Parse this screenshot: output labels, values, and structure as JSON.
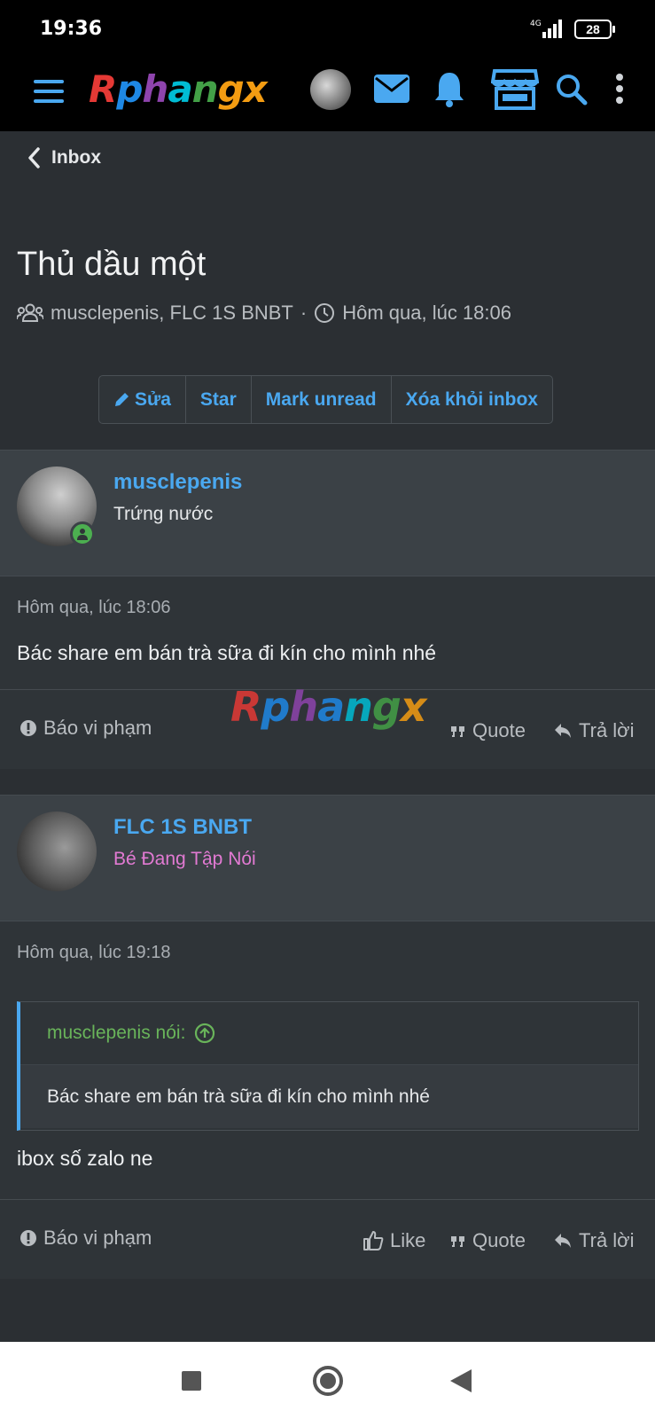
{
  "status_bar": {
    "time": "19:36",
    "network": "4G",
    "battery": "28"
  },
  "header": {
    "logo": "Rphangx"
  },
  "page": {
    "back_label": "Inbox",
    "title": "Thủ dầu một",
    "participants": "musclepenis, FLC 1S BNBT",
    "separator": "·",
    "time": "Hôm qua, lúc 18:06"
  },
  "buttons": {
    "edit": "Sửa",
    "star": "Star",
    "mark_unread": "Mark unread",
    "remove": "Xóa khỏi inbox"
  },
  "messages": [
    {
      "user": "musclepenis",
      "user_title": "Trứng nước",
      "user_title_color": "#e6e8ea",
      "date": "Hôm qua, lúc 18:06",
      "body": "Bác share em bán trà sữa đi kín cho mình nhé",
      "report": "Báo vi phạm",
      "quote": "Quote",
      "reply": "Trả lời"
    },
    {
      "user": "FLC 1S BNBT",
      "user_title": "Bé Đang Tập Nói",
      "user_title_color": "#e27ad3",
      "date": "Hôm qua, lúc 19:18",
      "quote_author": "musclepenis nói:",
      "quote_text": "Bác share em bán trà sữa đi kín cho mình nhé",
      "body": "ibox số zalo ne",
      "report": "Báo vi phạm",
      "like": "Like",
      "quote": "Quote",
      "reply": "Trả lời"
    }
  ],
  "watermark": "Rphangx",
  "colors": {
    "accent": "#4aa8f0",
    "online": "#4caf50",
    "quote_author": "#69b45a"
  },
  "icons": [
    "menu-icon",
    "envelope-icon",
    "bell-icon",
    "store-icon",
    "search-icon",
    "more-vertical-icon",
    "chevron-left-icon",
    "users-icon",
    "clock-icon",
    "pencil-icon",
    "alert-icon",
    "quote-icon",
    "reply-icon",
    "thumbs-up-icon",
    "arrow-up-circle-icon"
  ]
}
